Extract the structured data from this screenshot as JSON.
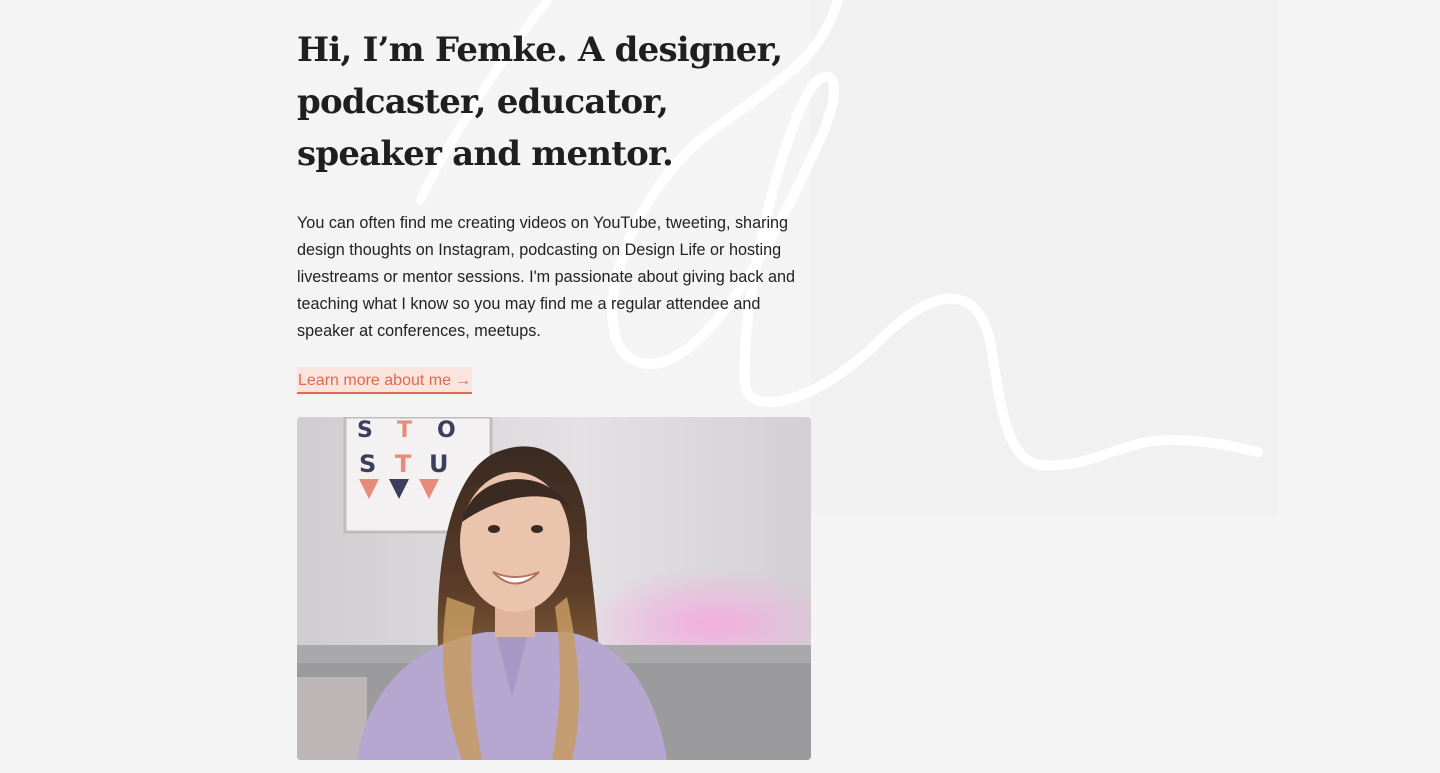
{
  "hero": {
    "headline": "Hi, I’m Femke. A designer, podcaster, educator, speaker and mentor.",
    "intro": "You can often find me creating videos on YouTube, tweeting, sharing design thoughts on Instagram, podcasting on Design Life or hosting livestreams or mentor sessions. I'm passionate about giving back and teaching what I know so you may find me a regular attendee and speaker at conferences, meetups.",
    "link_label": "Learn more about me",
    "link_arrow": "→"
  },
  "photo": {
    "poster_letters": [
      "S",
      "T",
      "U"
    ]
  },
  "colors": {
    "background": "#f4f4f4",
    "accent": "#e06a4f",
    "link_highlight": "#fbe4dd",
    "text": "#1e1e1e"
  }
}
